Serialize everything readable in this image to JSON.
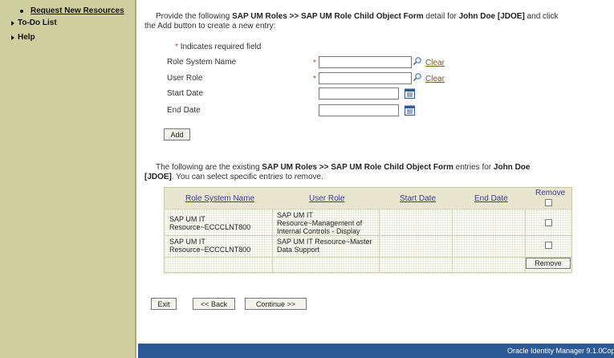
{
  "sidebar": {
    "sub_item": "Request New Resources",
    "todo": "To-Do List",
    "help": "Help"
  },
  "intro": {
    "part1": "Provide the following ",
    "bold1": "SAP UM Roles >> SAP UM Role Child Object Form",
    "part2": " detail for ",
    "bold2": "John Doe [JDOE]",
    "part3": " and click the Add button to create a new entry:"
  },
  "required_note": "Indicates required field",
  "required_star": "*",
  "form": {
    "role_system_name": "Role System Name",
    "user_role": "User Role",
    "start_date": "Start Date",
    "end_date": "End Date",
    "clear": "Clear"
  },
  "buttons": {
    "add": "Add",
    "remove": "Remove",
    "exit": "Exit",
    "back": "<< Back",
    "continue": "Continue >>"
  },
  "existing": {
    "part1": "The following are the existing ",
    "bold1": "SAP UM Roles >> SAP UM Role Child Object Form",
    "part2": " entries for ",
    "bold2": "John Doe [JDOE]",
    "part3": ". You can select specific entries to remove."
  },
  "table": {
    "headers": [
      "Role System Name",
      "User Role",
      "Start Date",
      "End Date",
      "Remove"
    ],
    "rows": [
      {
        "role_system": "SAP UM IT Resource~ECCCLNT800",
        "user_role": "SAP UM IT Resource~Management of Internal Controls - Display",
        "start": "",
        "end": ""
      },
      {
        "role_system": "SAP UM IT Resource~ECCCLNT800",
        "user_role": "SAP UM IT Resource~Master Data Support",
        "start": "",
        "end": ""
      }
    ]
  },
  "footer": {
    "product": "Oracle Identity Manager 9.1.0",
    "copyright": "Cop"
  }
}
